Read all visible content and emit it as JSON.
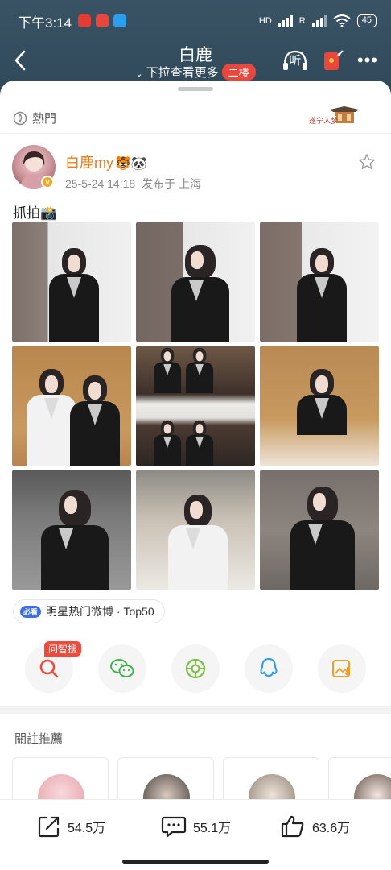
{
  "status": {
    "time": "下午3:14",
    "signal1": "HD",
    "signal2": "R",
    "battery": "45"
  },
  "nav": {
    "title": "白鹿",
    "subtitle": "下拉查看更多",
    "floor_badge": "二楼",
    "listen_label": "听"
  },
  "section": {
    "hot_label": "熱門"
  },
  "post": {
    "author_name": "白鹿my",
    "author_emoji": "🐯🐼",
    "verified_mark": "v",
    "date": "25-5-24 14:18",
    "location": "发布于 上海",
    "text": "抓拍📸",
    "tag_badge": "必看",
    "tag_text": "明星热门微博 · Top50"
  },
  "share": {
    "zhisou_label": "问智搜"
  },
  "recommend": {
    "title": "關註推薦"
  },
  "actions": {
    "repost_count": "54.5万",
    "comment_count": "55.1万",
    "like_count": "63.6万"
  },
  "colors": {
    "accent": "#eb7b1c",
    "badge_red": "#e8473e",
    "wechat_green": "#3cb44b",
    "moments_green": "#7bc043",
    "qq_blue": "#2b9ef0",
    "save_orange": "#f0a020"
  }
}
